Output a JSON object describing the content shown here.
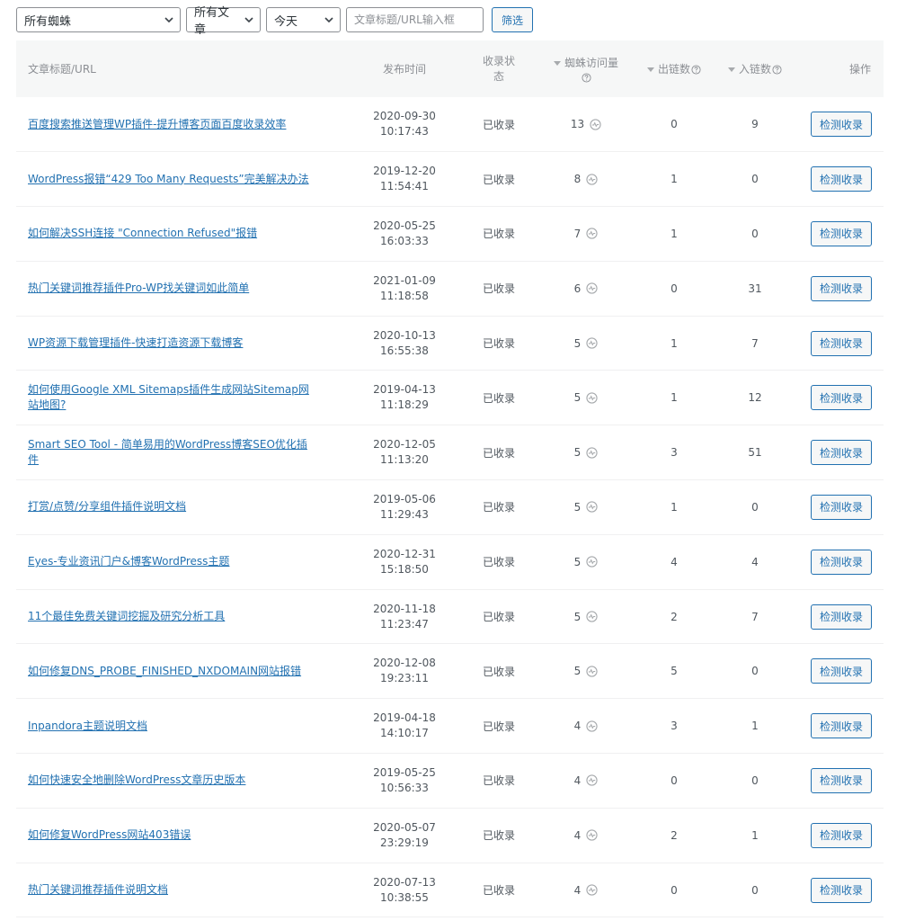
{
  "filters": {
    "spider_select": "所有蜘蛛",
    "posts_select": "所有文章",
    "time_select": "今天",
    "search_placeholder": "文章标题/URL输入框",
    "filter_button": "筛选"
  },
  "table": {
    "headers": {
      "title": "文章标题/URL",
      "publish_time": "发布时间",
      "index_status": "收录状态",
      "spider_visits": "蜘蛛访问量",
      "outlinks": "出链数",
      "inlinks": "入链数",
      "actions": "操作"
    },
    "rows": [
      {
        "title": "百度搜索推送管理WP插件-提升博客页面百度收录效率",
        "date": "2020-09-30",
        "time": "10:17:43",
        "status": "已收录",
        "visits": "13",
        "out": "0",
        "in": "9",
        "action": "检测收录"
      },
      {
        "title": "WordPress报错“429 Too Many Requests”完美解决办法",
        "date": "2019-12-20",
        "time": "11:54:41",
        "status": "已收录",
        "visits": "8",
        "out": "1",
        "in": "0",
        "action": "检测收录"
      },
      {
        "title": "如何解决SSH连接 \"Connection Refused\"报错",
        "date": "2020-05-25",
        "time": "16:03:33",
        "status": "已收录",
        "visits": "7",
        "out": "1",
        "in": "0",
        "action": "检测收录"
      },
      {
        "title": "热门关键词推荐插件Pro-WP找关键词如此简单",
        "date": "2021-01-09",
        "time": "11:18:58",
        "status": "已收录",
        "visits": "6",
        "out": "0",
        "in": "31",
        "action": "检测收录"
      },
      {
        "title": "WP资源下载管理插件-快速打造资源下载博客",
        "date": "2020-10-13",
        "time": "16:55:38",
        "status": "已收录",
        "visits": "5",
        "out": "1",
        "in": "7",
        "action": "检测收录"
      },
      {
        "title": "如何使用Google XML Sitemaps插件生成网站Sitemap网站地图?",
        "date": "2019-04-13",
        "time": "11:18:29",
        "status": "已收录",
        "visits": "5",
        "out": "1",
        "in": "12",
        "action": "检测收录"
      },
      {
        "title": "Smart SEO Tool - 简单易用的WordPress博客SEO优化插件",
        "date": "2020-12-05",
        "time": "11:13:20",
        "status": "已收录",
        "visits": "5",
        "out": "3",
        "in": "51",
        "action": "检测收录"
      },
      {
        "title": "打赏/点赞/分享组件插件说明文档",
        "date": "2019-05-06",
        "time": "11:29:43",
        "status": "已收录",
        "visits": "5",
        "out": "1",
        "in": "0",
        "action": "检测收录"
      },
      {
        "title": "Eyes-专业资讯门户&博客WordPress主题",
        "date": "2020-12-31",
        "time": "15:18:50",
        "status": "已收录",
        "visits": "5",
        "out": "4",
        "in": "4",
        "action": "检测收录"
      },
      {
        "title": "11个最佳免费关键词挖掘及研究分析工具",
        "date": "2020-11-18",
        "time": "11:23:47",
        "status": "已收录",
        "visits": "5",
        "out": "2",
        "in": "7",
        "action": "检测收录"
      },
      {
        "title": "如何修复DNS_PROBE_FINISHED_NXDOMAIN网站报错",
        "date": "2020-12-08",
        "time": "19:23:11",
        "status": "已收录",
        "visits": "5",
        "out": "5",
        "in": "0",
        "action": "检测收录"
      },
      {
        "title": "Inpandora主题说明文档",
        "date": "2019-04-18",
        "time": "14:10:17",
        "status": "已收录",
        "visits": "4",
        "out": "3",
        "in": "1",
        "action": "检测收录"
      },
      {
        "title": "如何快速安全地删除WordPress文章历史版本",
        "date": "2019-05-25",
        "time": "10:56:33",
        "status": "已收录",
        "visits": "4",
        "out": "0",
        "in": "0",
        "action": "检测收录"
      },
      {
        "title": "如何修复WordPress网站403错误",
        "date": "2020-05-07",
        "time": "23:29:19",
        "status": "已收录",
        "visits": "4",
        "out": "2",
        "in": "1",
        "action": "检测收录"
      },
      {
        "title": "热门关键词推荐插件说明文档",
        "date": "2020-07-13",
        "time": "10:38:55",
        "status": "已收录",
        "visits": "4",
        "out": "0",
        "in": "0",
        "action": "检测收录"
      }
    ]
  }
}
